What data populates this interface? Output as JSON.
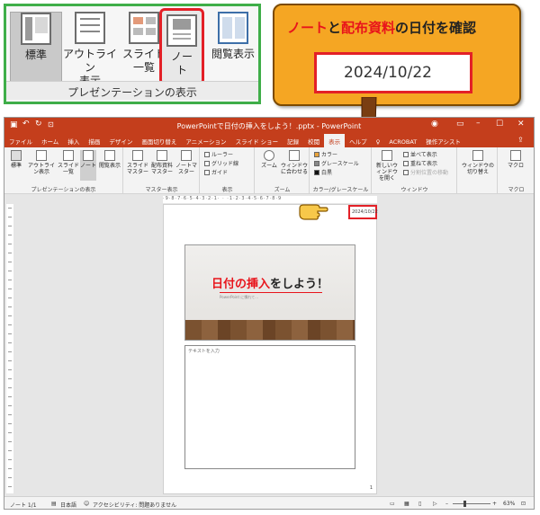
{
  "zoomed_group": {
    "buttons": [
      {
        "label": "標準",
        "icon": "normal-view-icon"
      },
      {
        "label": "アウトライン\n表示",
        "icon": "outline-view-icon"
      },
      {
        "label": "スライド\n一覧",
        "icon": "slide-sorter-icon"
      },
      {
        "label": "ノー\nト",
        "icon": "notes-page-icon"
      },
      {
        "label": "閲覧表示",
        "icon": "reading-view-icon"
      }
    ],
    "group_label": "プレゼンテーションの表示"
  },
  "callout": {
    "title_red_1": "ノート",
    "title_black_1": "と",
    "title_red_2": "配布資料",
    "title_black_2": "の日付を確認",
    "date": "2024/10/22"
  },
  "window": {
    "title": "PowerPointで日付の挿入をしよう！.pptx - PowerPoint",
    "tabs": [
      "ファイル",
      "ホーム",
      "挿入",
      "描画",
      "デザイン",
      "画面切り替え",
      "アニメーション",
      "スライド ショー",
      "記録",
      "校閲",
      "表示",
      "ヘルプ",
      "♀",
      "ACROBAT",
      "操作アシスト"
    ],
    "selected_tab": "表示",
    "ribbon": {
      "pres_view": {
        "label": "プレゼンテーションの表示",
        "buttons": [
          "標準",
          "アウトライン表示",
          "スライド一覧",
          "ノート",
          "閲覧表示"
        ]
      },
      "master_view": {
        "label": "マスター表示",
        "buttons": [
          "スライドマスター",
          "配布資料マスター",
          "ノートマスター"
        ]
      },
      "show": {
        "label": "表示",
        "checks": [
          "ルーラー",
          "グリッド線",
          "ガイド"
        ]
      },
      "zoom": {
        "label": "ズーム",
        "buttons": [
          "ズーム",
          "ウィンドウに合わせる"
        ]
      },
      "color": {
        "label": "カラー/グレースケール",
        "items": [
          "カラー",
          "グレースケール",
          "白黒"
        ]
      },
      "window": {
        "label": "ウィンドウ",
        "buttons": [
          "新しいウィンドウを開く",
          "並べて表示",
          "重ねて表示",
          "分割位置の移動"
        ]
      },
      "switch": {
        "button": "ウィンドウの切り替え"
      },
      "macro": {
        "label": "マクロ",
        "button": "マクロ"
      }
    }
  },
  "page": {
    "header_date": "2024/10/22",
    "slide_title_red": "日付の挿入",
    "slide_title_black": "をしよう！",
    "slide_subtitle": "PowerPoint に慣れて…",
    "notes_placeholder": "テキストを入力",
    "page_number": "1",
    "ruler_text": "·9·8·7·6·5·4·3·2·1· · ·1·2·3·4·5·6·7·8·9"
  },
  "status": {
    "page": "ノート 1/1",
    "language": "日本語",
    "accessibility": "アクセシビリティ: 問題ありません",
    "zoom": "63%"
  },
  "colors": {
    "accent": "#c43e1c",
    "callout": "#f5a623",
    "highlight": "#e32027",
    "group_border": "#3fae49"
  }
}
